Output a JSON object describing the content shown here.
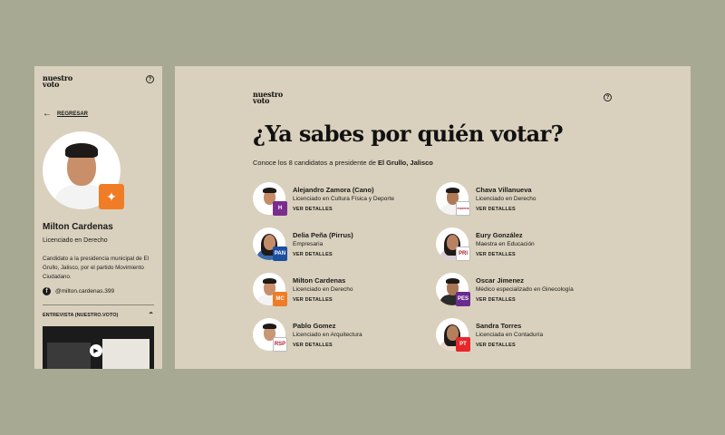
{
  "brand": {
    "logo_line1": "nuestro",
    "logo_line2": "voto",
    "help_glyph": "?"
  },
  "mobile": {
    "back_label": "REGRESAR",
    "candidate_name": "Milton Cardenas",
    "candidate_title": "Licenciado en Derecho",
    "description": "Candidato a la presidencia municipal de El Grullo, Jalisco, por el partido Movimiento Ciudadano.",
    "social_handle": "@milton.cardenas.399",
    "interview_label": "ENTREVISTA (NUESTRO.VOTO)",
    "party_color": "#f07c25"
  },
  "desktop": {
    "title": "¿Ya sabes por quién votar?",
    "subtitle_prefix": "Conoce los 8 candidatos a presidente de ",
    "subtitle_place": "El Grullo, Jalisco",
    "details_label": "VER DETALLES",
    "candidates": [
      {
        "name": "Alejandro Zamora (Cano)",
        "profession": "Licenciado en Cultura Física y Deporte",
        "party": "H",
        "party_color": "#7b2d8e",
        "badge_text": "H"
      },
      {
        "name": "Chava Villanueva",
        "profession": "Licenciado en Derecho",
        "party": "morena",
        "party_color": "#ffffff",
        "badge_text": "morena"
      },
      {
        "name": "Delia Peña (Pirrus)",
        "profession": "Empresaria",
        "party": "PAN",
        "party_color": "#1c4fa1",
        "badge_text": "PAN"
      },
      {
        "name": "Eury González",
        "profession": "Maestra en Educación",
        "party": "PRI",
        "party_color": "#ffffff",
        "badge_text": "PRI"
      },
      {
        "name": "Milton Cardenas",
        "profession": "Licenciado en Derecho",
        "party": "MC",
        "party_color": "#f07c25",
        "badge_text": "MC"
      },
      {
        "name": "Oscar Jimenez",
        "profession": "Médico especializado en Ginecología",
        "party": "PES",
        "party_color": "#6a2c8c",
        "badge_text": "PES"
      },
      {
        "name": "Pablo Gomez",
        "profession": "Licenciado en Arquitectura",
        "party": "RSP",
        "party_color": "#ffffff",
        "badge_text": "RSP"
      },
      {
        "name": "Sandra Torres",
        "profession": "Licenciada en Contaduría",
        "party": "PT",
        "party_color": "#e8262a",
        "badge_text": "PT"
      }
    ]
  }
}
